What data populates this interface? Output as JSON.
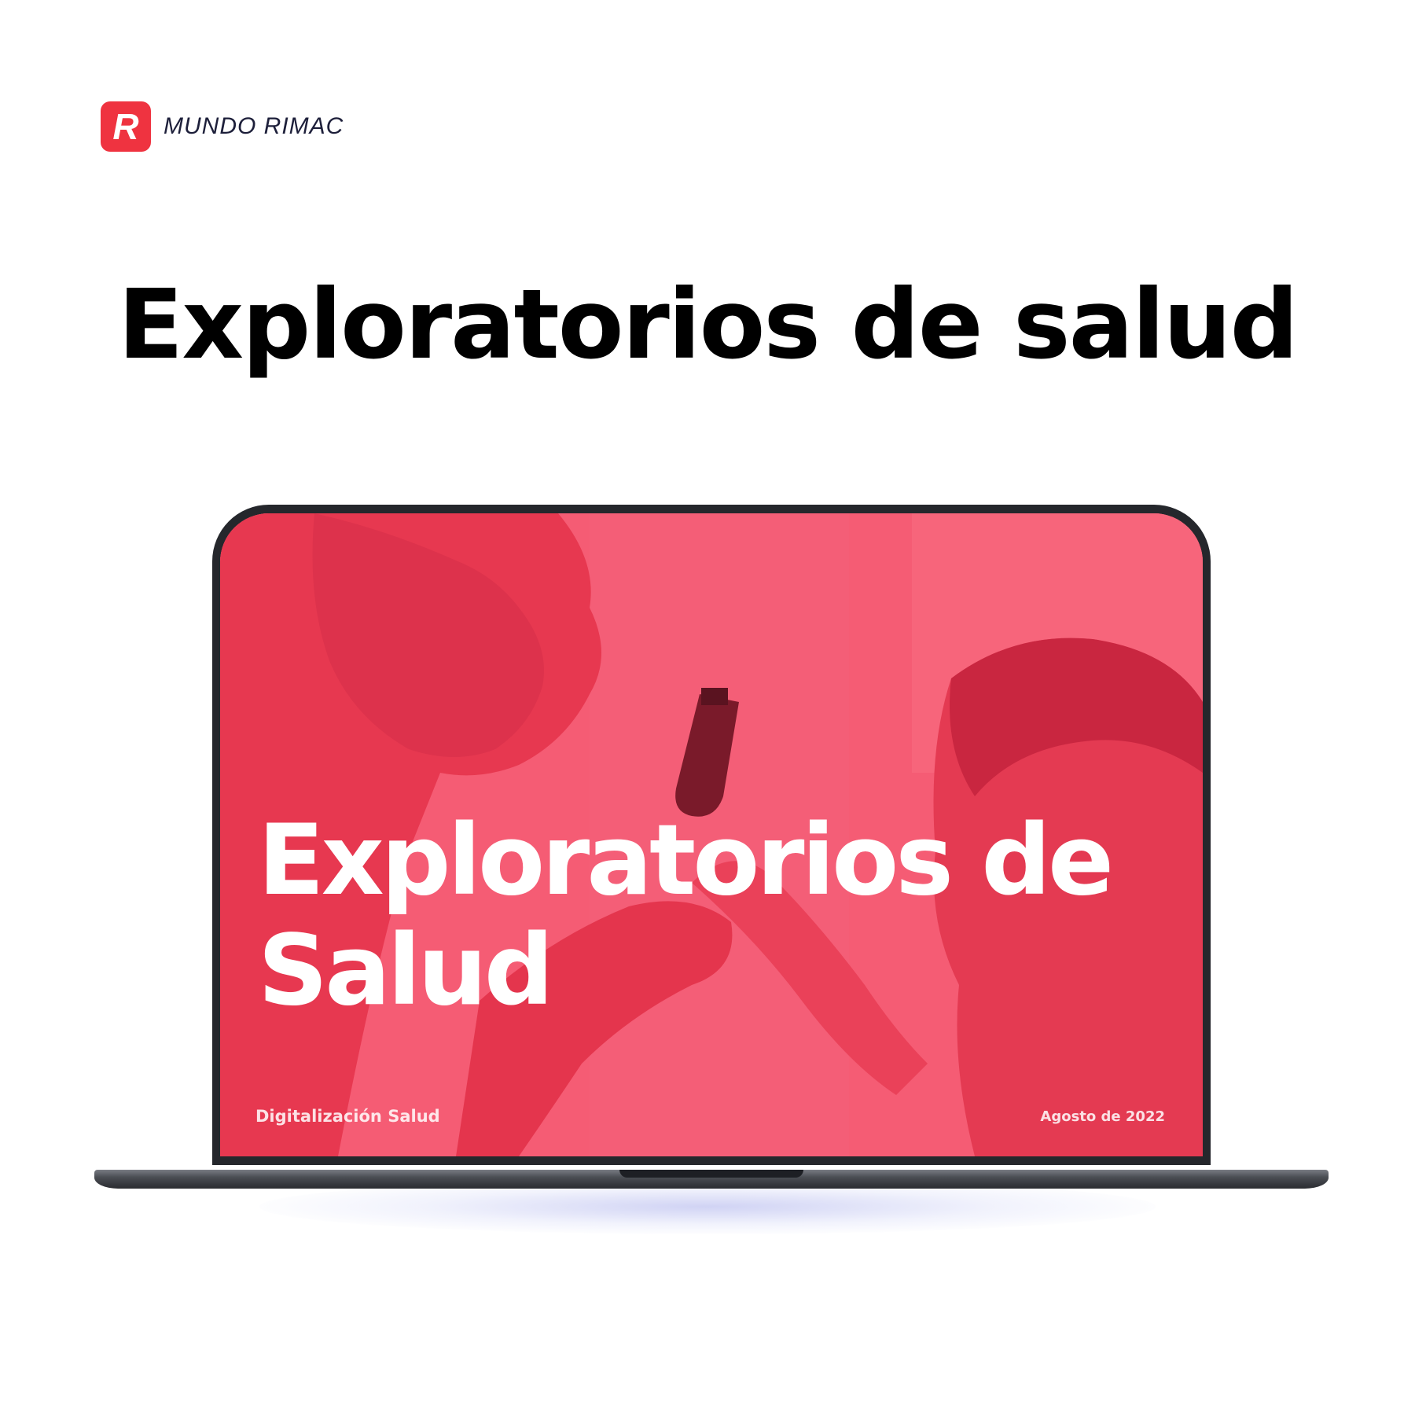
{
  "brand": {
    "mark_letter": "R",
    "name": "MUNDO RIMAC",
    "color": "#ef3340"
  },
  "headline": "Exploratorios de salud",
  "slide": {
    "title": "Exploratorios de Salud",
    "footer_left": "Digitalización Salud",
    "footer_right": "Agosto de 2022",
    "overlay_color": "#f3566e"
  }
}
